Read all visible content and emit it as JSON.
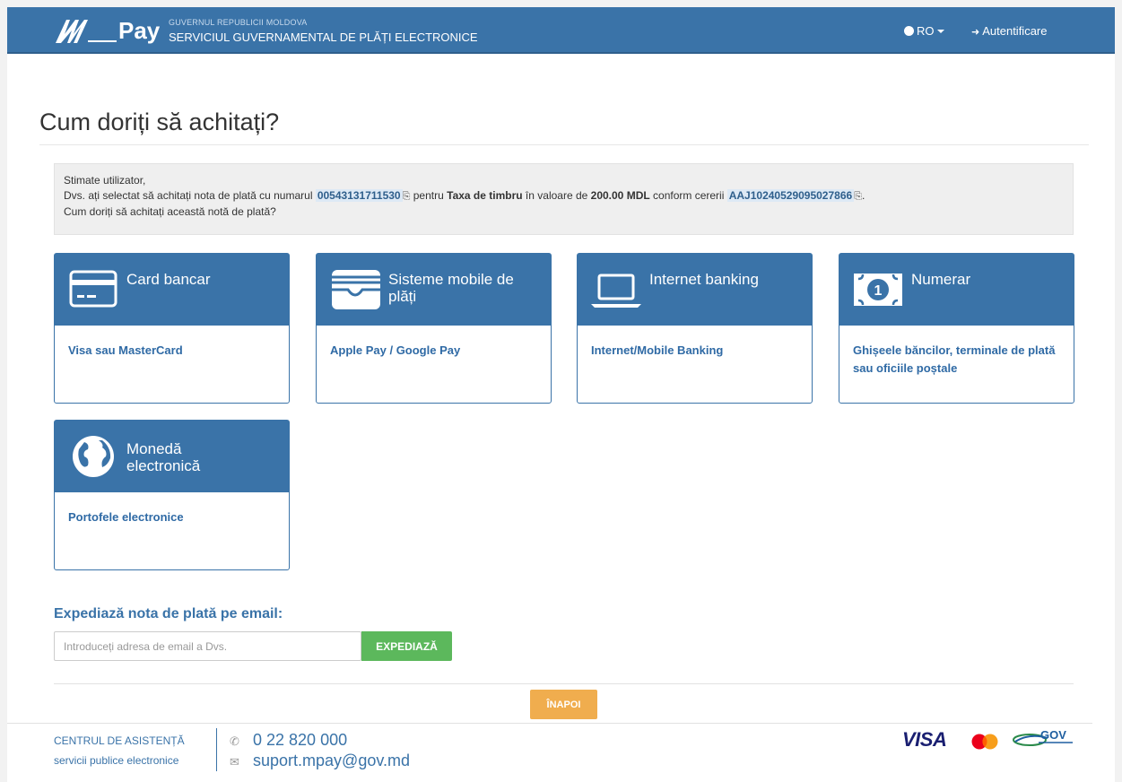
{
  "header": {
    "logo_text": "Pay",
    "gov_small": "GUVERNUL REPUBLICII MOLDOVA",
    "gov_big": "SERVICIUL GUVERNAMENTAL DE PLĂȚI ELECTRONICE",
    "language": "RO",
    "login": "Autentificare"
  },
  "page_title": "Cum doriți să achitați?",
  "info": {
    "greeting": "Stimate utilizator,",
    "line2_a": "Dvs. ați selectat să achitați nota de plată cu numarul ",
    "invoice_number": "00543131711530",
    "line2_b": " pentru ",
    "service": "Taxa de timbru",
    "line2_c": " în valoare de ",
    "amount": "200.00 MDL",
    "line2_d": " conform cererii ",
    "request_id": "AAJ10240529095027866",
    "line3": "Cum doriți să achitați această notă de plată?"
  },
  "methods": [
    {
      "title": "Card bancar",
      "desc": "Visa sau MasterCard",
      "icon": "credit-card-icon"
    },
    {
      "title": "Sisteme mobile de plăți",
      "desc": "Apple Pay / Google Pay",
      "icon": "wallet-icon"
    },
    {
      "title": "Internet banking",
      "desc": "Internet/Mobile Banking",
      "icon": "laptop-icon"
    },
    {
      "title": "Numerar",
      "desc": "Ghișeele băncilor, terminale de plată sau oficiile poștale",
      "icon": "banknote-icon"
    },
    {
      "title": "Monedă electronică",
      "desc": "Portofele electronice",
      "icon": "globe-icon"
    }
  ],
  "email": {
    "label": "Expediază nota de plată pe email:",
    "placeholder": "Introduceți adresa de email a Dvs.",
    "button": "EXPEDIAZĂ"
  },
  "back_button": "ÎNAPOI",
  "footer": {
    "center_title": "CENTRUL DE ASISTENȚĂ",
    "center_sub": "servicii publice electronice",
    "phone": "0 22 820 000",
    "mail": "suport.mpay@gov.md",
    "visa": "VISA",
    "gov": "GOV"
  },
  "colors": {
    "primary": "#3a73a8",
    "success": "#5cb85c",
    "warning": "#f0ad4e"
  }
}
